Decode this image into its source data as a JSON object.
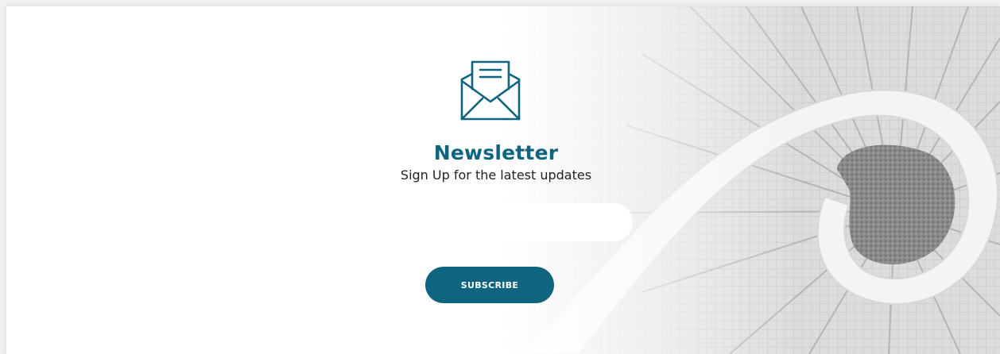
{
  "newsletter": {
    "title": "Newsletter",
    "subtitle": "Sign Up for the latest updates",
    "email_value": "",
    "email_placeholder": "",
    "subscribe_label": "SUBSCRIBE",
    "icon": "envelope-letter-icon",
    "background": "spiral-staircase-photo"
  },
  "colors": {
    "accent": "#0f6480",
    "text": "#222222",
    "background": "#ffffff"
  }
}
